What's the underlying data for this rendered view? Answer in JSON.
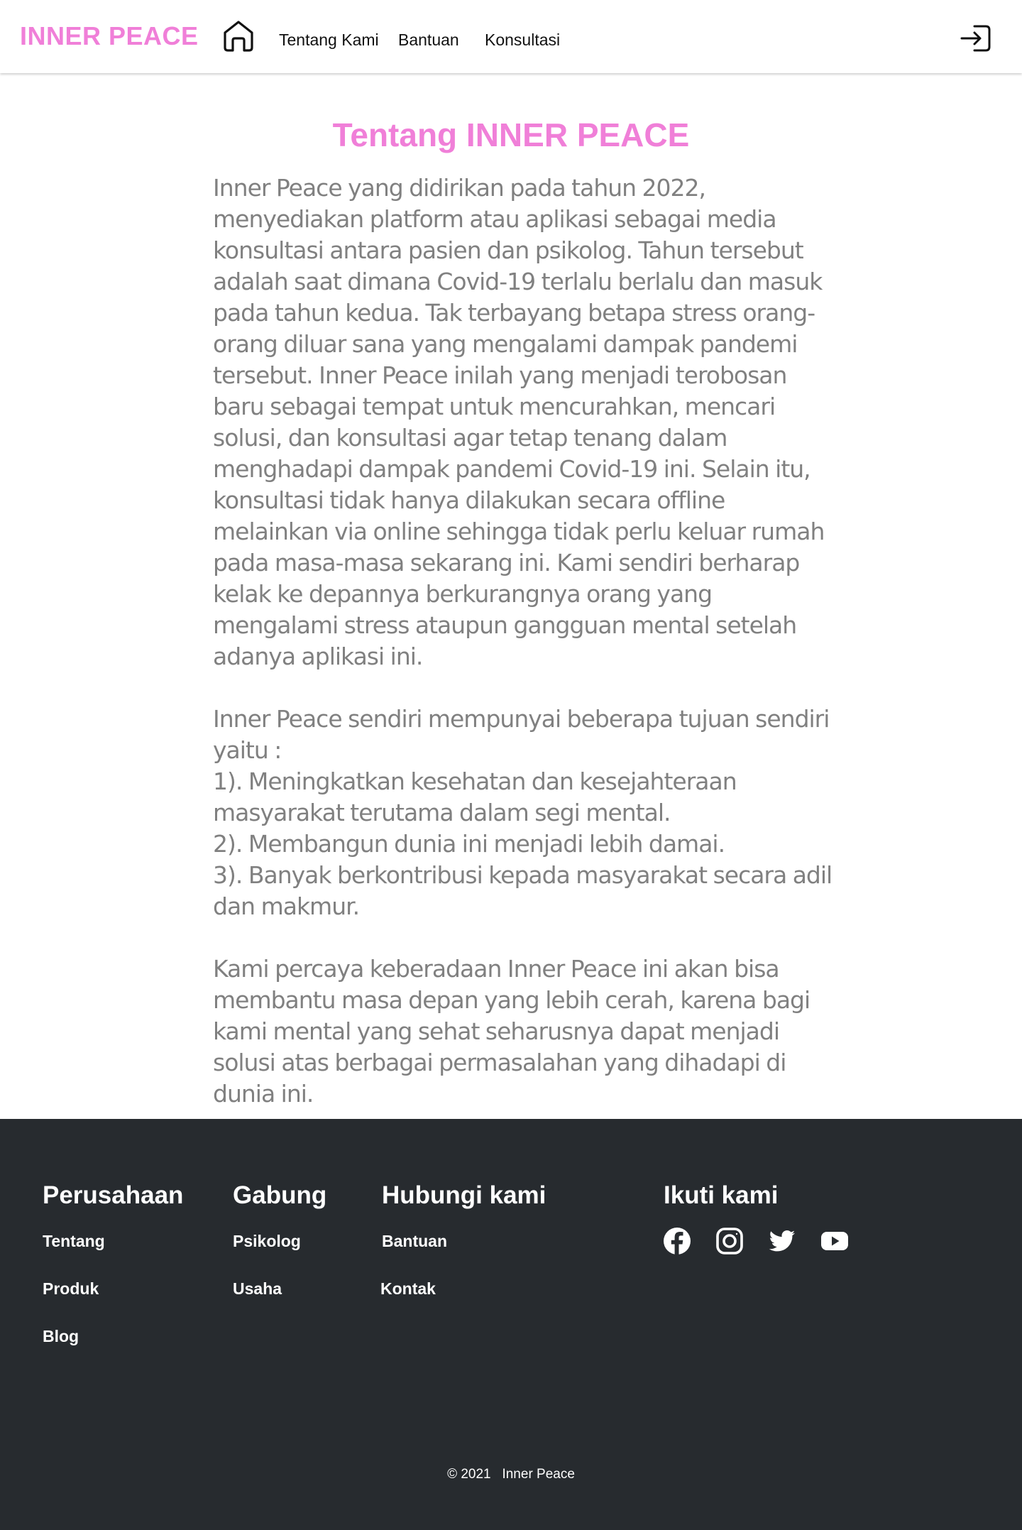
{
  "header": {
    "brand": "INNER PEACE",
    "nav": {
      "home_icon": "home-icon",
      "tentang": "Tentang Kami",
      "bantuan": "Bantuan",
      "konsultasi": "Konsultasi"
    },
    "login_icon": "login-icon"
  },
  "main": {
    "title": "Tentang INNER PEACE",
    "paragraph1": "Inner Peace yang didirikan pada tahun 2022, menyediakan platform atau aplikasi sebagai media konsultasi antara pasien dan psikolog. Tahun tersebut adalah saat dimana Covid-19 terlalu berlalu dan masuk pada tahun kedua. Tak terbayang betapa stress orang-orang diluar sana yang mengalami dampak pandemi tersebut. Inner Peace inilah yang menjadi terobosan baru sebagai tempat untuk mencurahkan, mencari solusi, dan konsultasi agar tetap tenang dalam menghadapi dampak pandemi Covid-19 ini. Selain itu, konsultasi tidak hanya dilakukan secara offline melainkan via online sehingga tidak perlu keluar rumah pada masa-masa sekarang ini. Kami sendiri berharap kelak ke depannya berkurangnya orang yang mengalami stress ataupun gangguan mental setelah adanya aplikasi ini.",
    "goals_intro": "Inner Peace sendiri mempunyai beberapa tujuan sendiri yaitu :",
    "goals": [
      "1). Meningkatkan kesehatan dan kesejahteraan masyarakat terutama dalam segi mental.",
      "2). Membangun dunia ini menjadi lebih damai.",
      "3). Banyak berkontribusi kepada masyarakat secara adil dan makmur."
    ],
    "paragraph3": "Kami percaya keberadaan Inner Peace ini akan bisa membantu masa depan yang lebih cerah, karena bagi kami mental yang sehat seharusnya dapat menjadi solusi atas berbagai permasalahan yang dihadapi di dunia ini."
  },
  "footer": {
    "perusahaan": {
      "title": "Perusahaan",
      "links": [
        "Tentang",
        "Produk",
        "Blog"
      ]
    },
    "gabung": {
      "title": "Gabung",
      "links": [
        "Psikolog",
        "Usaha"
      ]
    },
    "hubungi": {
      "title": "Hubungi kami",
      "links": [
        "Bantuan",
        "Kontak"
      ]
    },
    "ikuti": {
      "title": "Ikuti kami",
      "icons": [
        "facebook-icon",
        "instagram-icon",
        "twitter-icon",
        "youtube-icon"
      ]
    },
    "copyright": "© 2021   Inner Peace"
  },
  "colors": {
    "brand_pink": "#f07fd8",
    "body_text": "#808080",
    "footer_bg": "#272b2f",
    "footer_text": "#ffffff"
  }
}
